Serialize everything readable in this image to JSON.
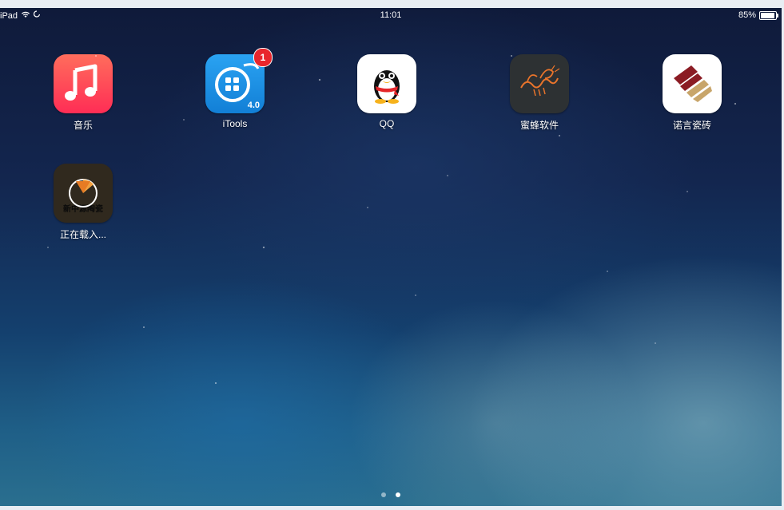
{
  "statusbar": {
    "carrier": "iPad",
    "time": "11:01",
    "battery": "85%",
    "battery_level": 0.85
  },
  "apps": [
    {
      "name": "音乐",
      "icon": "music-icon"
    },
    {
      "name": "iTools",
      "icon": "itools-icon",
      "badge": "1",
      "version_text": "4.0"
    },
    {
      "name": "QQ",
      "icon": "qq-penguin-icon"
    },
    {
      "name": "蜜蜂软件",
      "icon": "bee-icon"
    },
    {
      "name": "诺言瓷砖",
      "icon": "tile-logo-icon"
    },
    {
      "name": "正在载入...",
      "icon": "loading-app-icon",
      "icon_text": "新中源陶瓷"
    }
  ],
  "page_indicator": {
    "count": 2,
    "active": 2
  },
  "colors": {
    "music_bg_top": "#ff6d5c",
    "music_bg_bottom": "#ff2d55",
    "itools_bg": "#1a8fe5",
    "badge": "#e8262c",
    "bee_bg": "#2d3133",
    "tile_bg": "#ffffff",
    "tile_red": "#8b1c24",
    "tile_gold": "#c8a56a"
  }
}
